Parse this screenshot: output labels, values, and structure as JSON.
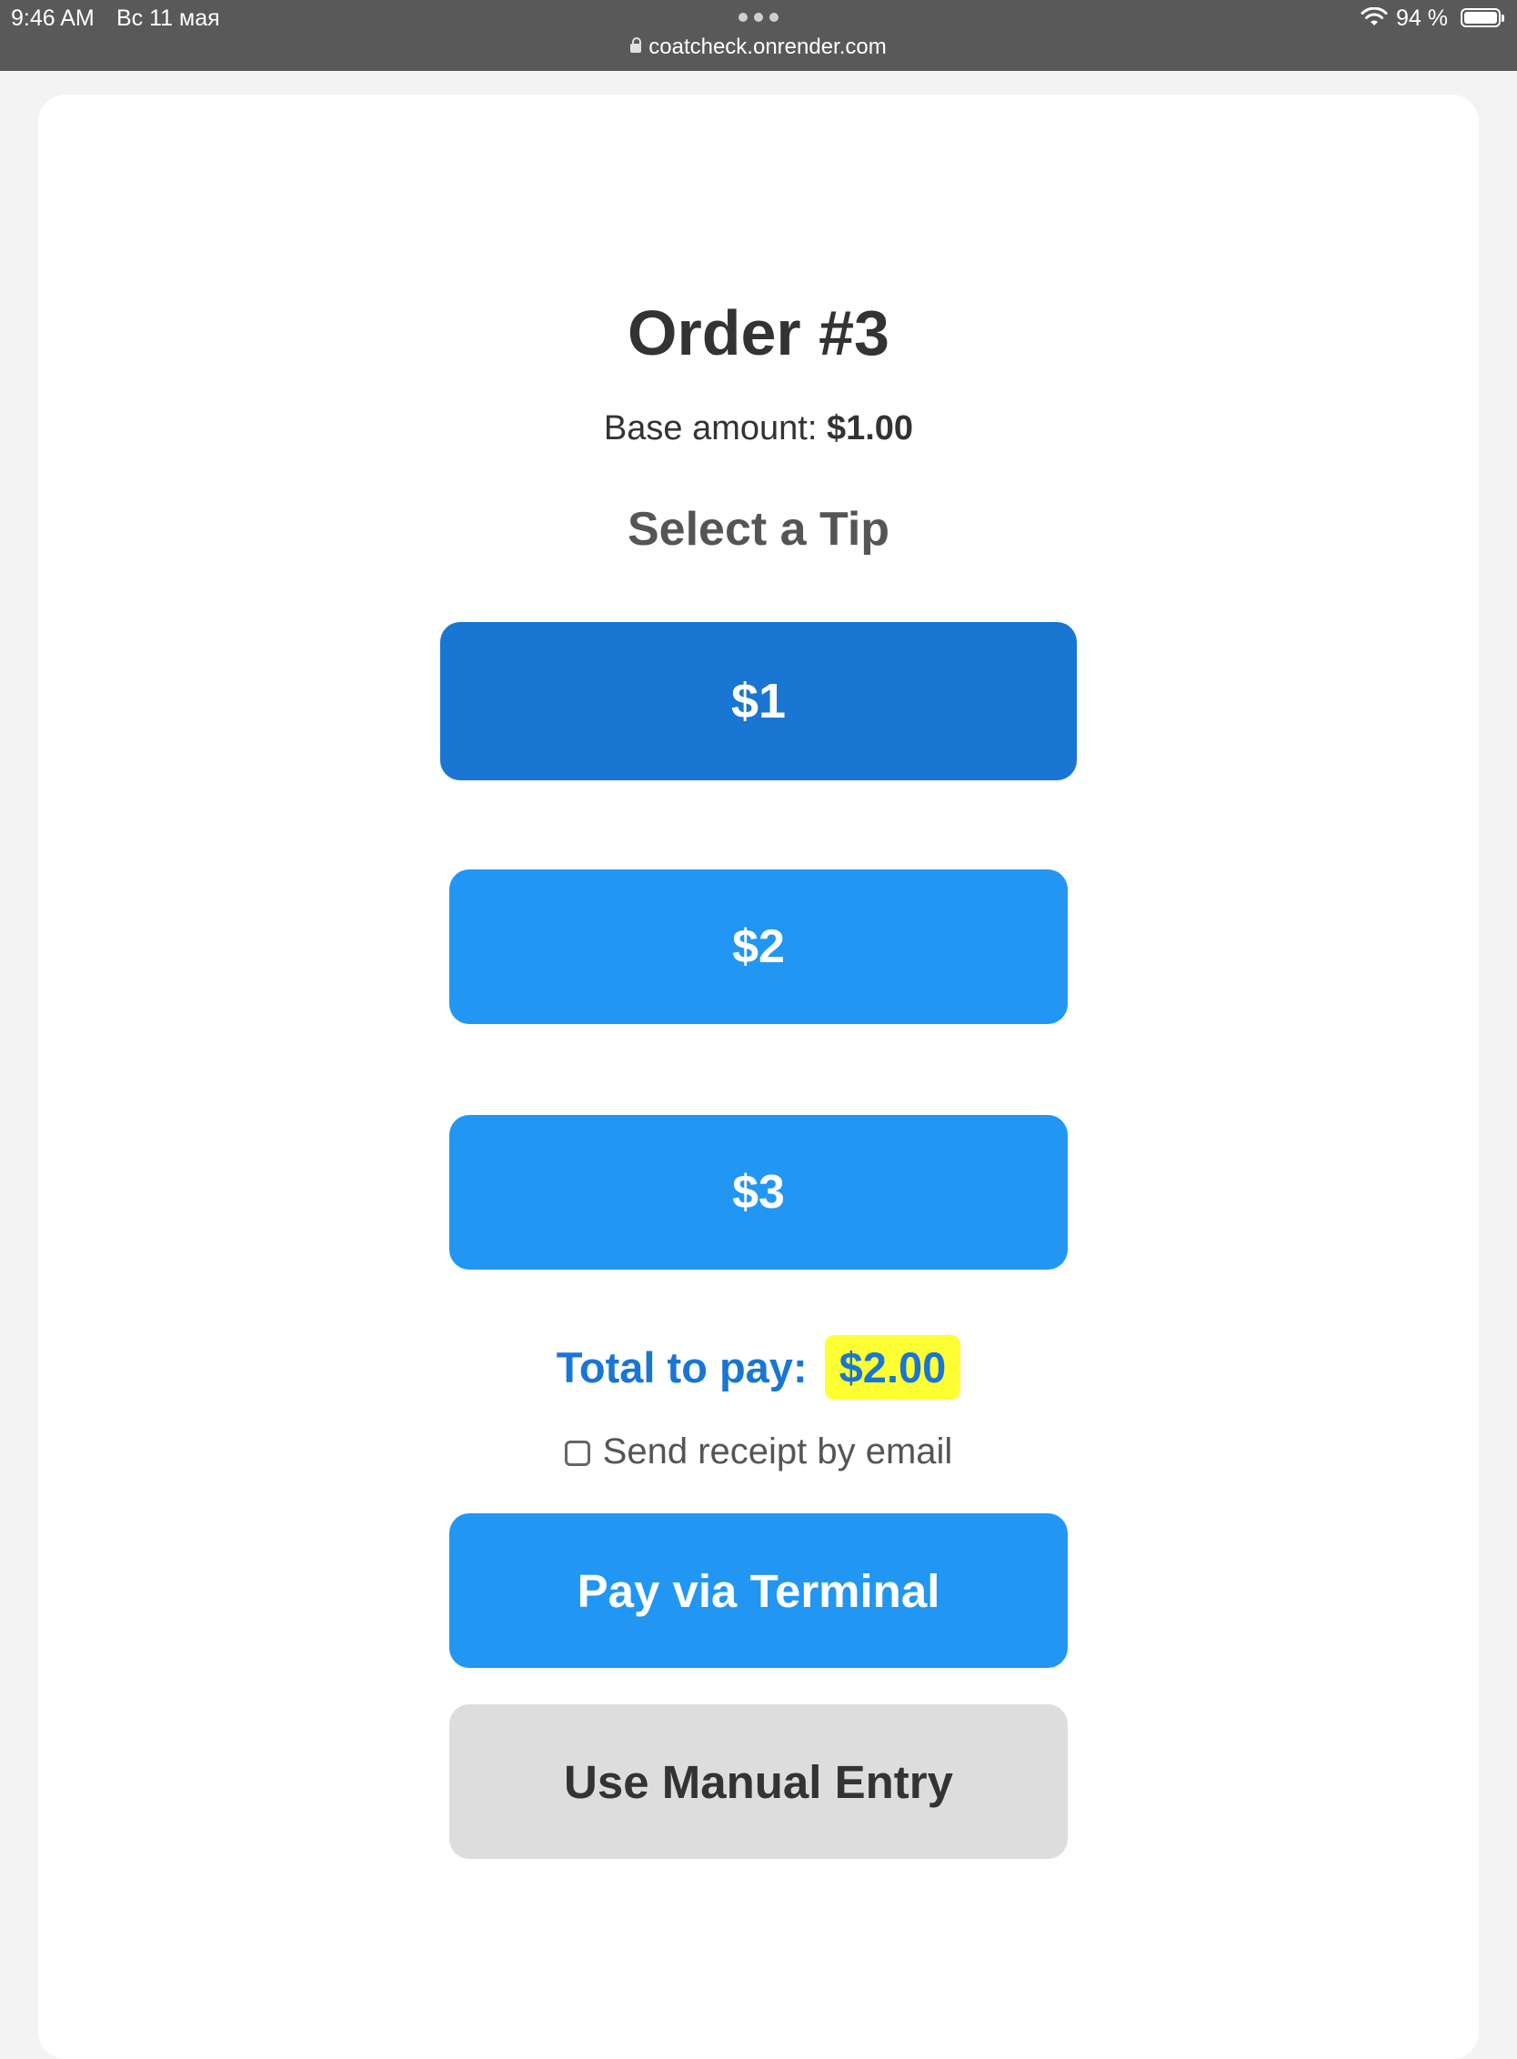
{
  "status_bar": {
    "time": "9:46 AM",
    "date": "Вс 11 мая",
    "url": "coatcheck.onrender.com",
    "battery_percent": "94 %",
    "battery_level": 0.94,
    "icons": [
      "wifi-icon",
      "battery-icon",
      "lock-icon",
      "more-dots-icon"
    ]
  },
  "order": {
    "title": "Order #3",
    "base_label": "Base amount:",
    "base_value": "$1.00",
    "tip_heading": "Select a Tip"
  },
  "tips": {
    "option1": "$1",
    "option2": "$2",
    "option3": "$3",
    "selected": "$1"
  },
  "total": {
    "label": "Total to pay:",
    "value": "$2.00"
  },
  "receipt": {
    "label": "Send receipt by email",
    "checked": false
  },
  "actions": {
    "pay_label": "Pay via Terminal",
    "manual_label": "Use Manual Entry"
  },
  "colors": {
    "selected_tip": "#1976d2",
    "tip_button": "#2196f3",
    "total_text": "#1976d2",
    "total_highlight": "#ffff33",
    "manual_button": "#dddddd"
  }
}
